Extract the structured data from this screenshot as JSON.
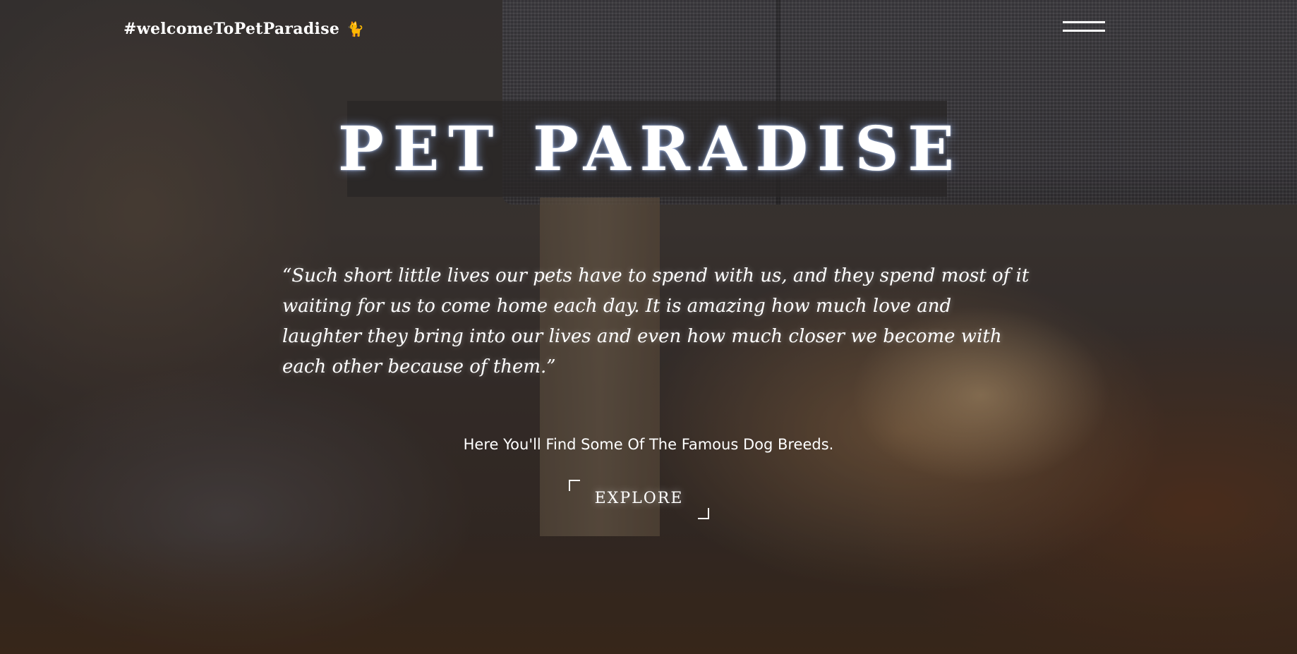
{
  "header": {
    "brand_text": "#welcomeToPetParadise",
    "brand_icon": "🐈",
    "menu_icon": "hamburger-menu-icon"
  },
  "hero": {
    "title": "PET PARADISE",
    "quote": "“Such short little lives our pets have to spend with us, and they spend most of it waiting for us to come home each day. It is amazing how much love and laughter they bring into our lives and even how much closer we become with each other because of them.”",
    "subtitle": "Here You'll Find Some Of The Famous Dog Breeds.",
    "cta_label": "EXPLORE"
  },
  "colors": {
    "text": "#ffffff",
    "title_box": "#282626",
    "icon_accent": "#e49a4a"
  }
}
